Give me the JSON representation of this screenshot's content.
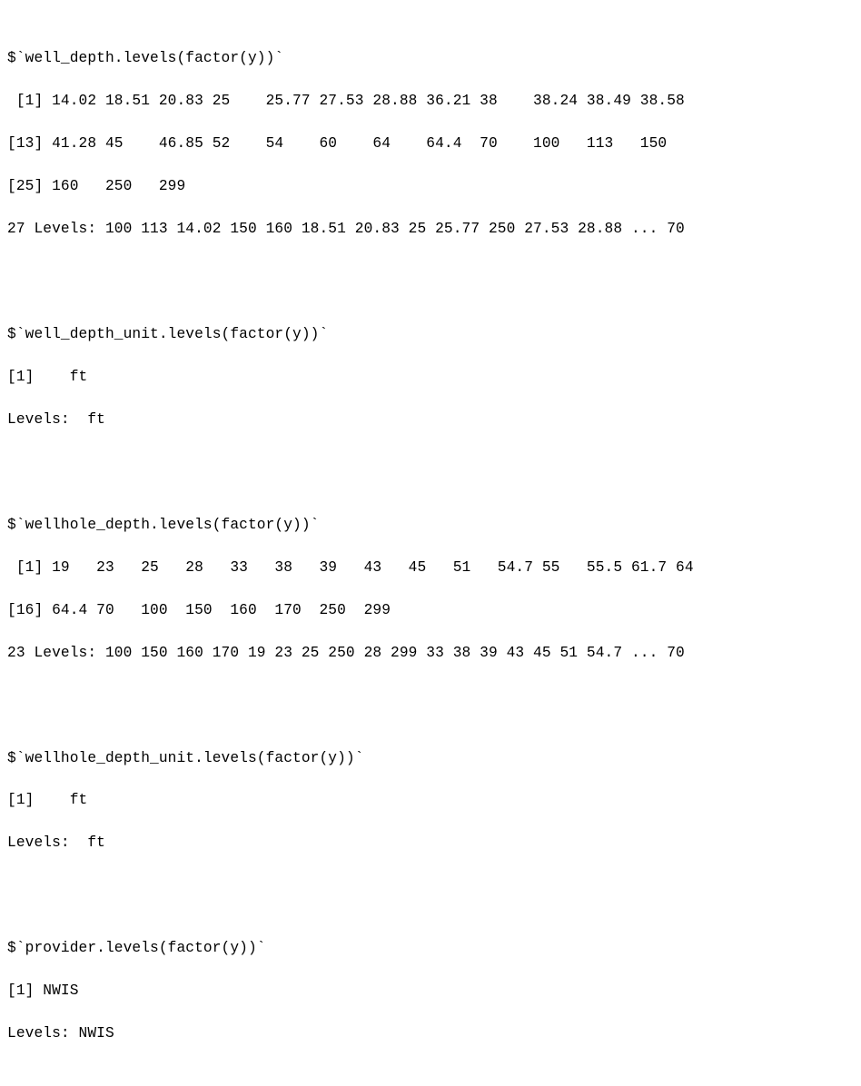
{
  "well_depth": {
    "header": "$`well_depth.levels(factor(y))`",
    "r1": " [1] 14.02 18.51 20.83 25    25.77 27.53 28.88 36.21 38    38.24 38.49 38.58",
    "r2": "[13] 41.28 45    46.85 52    54    60    64    64.4  70    100   113   150  ",
    "r3": "[25] 160   250   299  ",
    "levels": "27 Levels: 100 113 14.02 150 160 18.51 20.83 25 25.77 250 27.53 28.88 ... 70"
  },
  "well_depth_unit": {
    "header": "$`well_depth_unit.levels(factor(y))`",
    "r1": "[1]    ft",
    "levels": "Levels:  ft"
  },
  "wellhole_depth": {
    "header": "$`wellhole_depth.levels(factor(y))`",
    "r1": " [1] 19   23   25   28   33   38   39   43   45   51   54.7 55   55.5 61.7 64  ",
    "r2": "[16] 64.4 70   100  150  160  170  250  299 ",
    "levels": "23 Levels: 100 150 160 170 19 23 25 250 28 299 33 38 39 43 45 51 54.7 ... 70"
  },
  "wellhole_depth_unit": {
    "header": "$`wellhole_depth_unit.levels(factor(y))`",
    "r1": "[1]    ft",
    "levels": "Levels:  ft"
  },
  "provider": {
    "header": "$`provider.levels(factor(y))`",
    "r1": "[1] NWIS",
    "levels": "Levels: NWIS"
  }
}
